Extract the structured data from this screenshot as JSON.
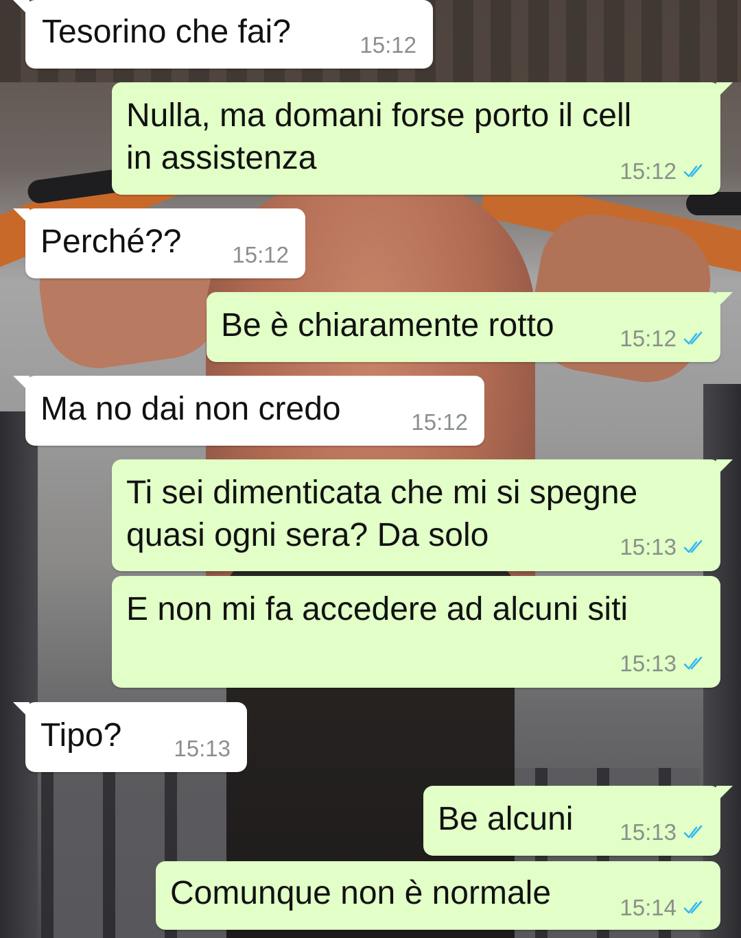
{
  "messages": [
    {
      "id": "m1",
      "direction": "incoming",
      "text": "Tesorino che fai?",
      "time": "15:12"
    },
    {
      "id": "m2",
      "direction": "outgoing",
      "text": "Nulla, ma domani forse porto il cell\nin assistenza",
      "time": "15:12",
      "status": "read"
    },
    {
      "id": "m3",
      "direction": "incoming",
      "text": "Perché??",
      "time": "15:12"
    },
    {
      "id": "m4",
      "direction": "outgoing",
      "text": "Be è chiaramente rotto",
      "time": "15:12",
      "status": "read"
    },
    {
      "id": "m5",
      "direction": "incoming",
      "text": "Ma no dai non credo",
      "time": "15:12"
    },
    {
      "id": "m6",
      "direction": "outgoing",
      "text": "Ti sei dimenticata che mi si spegne\nquasi ogni sera? Da solo",
      "time": "15:13",
      "status": "read"
    },
    {
      "id": "m7",
      "direction": "outgoing",
      "text": "E non mi fa accedere ad alcuni siti",
      "time": "15:13",
      "status": "read"
    },
    {
      "id": "m8",
      "direction": "incoming",
      "text": "Tipo?",
      "time": "15:13"
    },
    {
      "id": "m9",
      "direction": "outgoing",
      "text": "Be alcuni",
      "time": "15:13",
      "status": "read"
    },
    {
      "id": "m10",
      "direction": "outgoing",
      "text": "Comunque non è normale",
      "time": "15:14",
      "status": "read"
    }
  ],
  "colors": {
    "incoming_bubble": "#ffffff",
    "outgoing_bubble": "#e1ffc7",
    "read_check": "#34b7f1",
    "timestamp": "#8a8f8a"
  },
  "icons": {
    "read_receipt": "double-check-icon"
  }
}
